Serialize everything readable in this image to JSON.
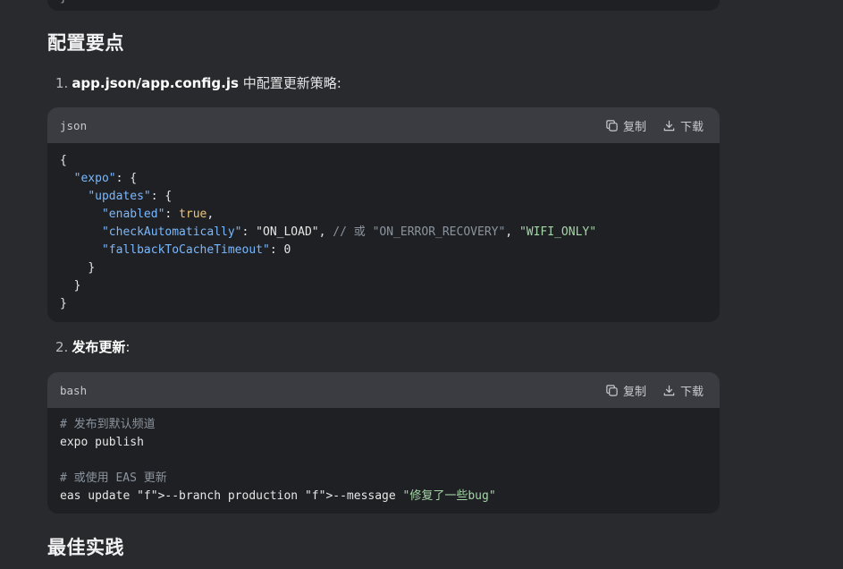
{
  "prev_block": {
    "trailing_line": "}"
  },
  "sections": {
    "config_heading": "配置要点",
    "best_heading": "最佳实践"
  },
  "steps": [
    {
      "number": "1.",
      "bold": "app.json/app.config.js",
      "text": " 中配置更新策略:"
    },
    {
      "number": "2.",
      "bold": "发布更新",
      "text": ":"
    }
  ],
  "code_actions": {
    "copy_label": "复制",
    "download_label": "下载"
  },
  "json_block": {
    "lang": "json",
    "lines": [
      "{",
      "  \"expo\": {",
      "    \"updates\": {",
      "      \"enabled\": true,",
      "      \"checkAutomatically\": \"ON_LOAD\", // 或 \"ON_ERROR_RECOVERY\", \"WIFI_ONLY\"",
      "      \"fallbackToCacheTimeout\": 0",
      "    }",
      "  }",
      "}"
    ]
  },
  "bash_block": {
    "lang": "bash",
    "lines": [
      "# 发布到默认频道",
      "expo publish",
      "",
      "# 或使用 EAS 更新",
      "eas update --branch production --message \"修复了一些bug\""
    ]
  },
  "colors": {
    "background": "#292a2d",
    "code_bg": "#1f2024",
    "code_header_bg": "#3b3c42",
    "key": "#79b8ff",
    "string": "#a5d6a7",
    "literal": "#f0c674",
    "comment": "#8b949e"
  }
}
